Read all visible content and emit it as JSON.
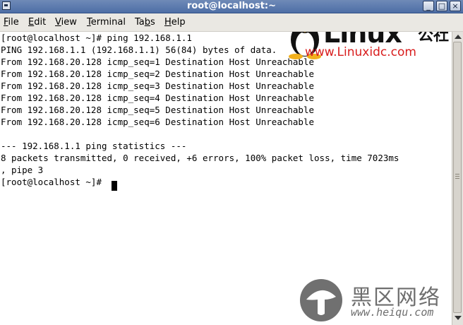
{
  "window": {
    "title": "root@localhost:~",
    "buttons": {
      "minimize": "_",
      "maximize": "□",
      "close": "×"
    }
  },
  "menu": {
    "items": [
      {
        "label_pre": "",
        "mnemonic": "F",
        "label_post": "ile"
      },
      {
        "label_pre": "",
        "mnemonic": "E",
        "label_post": "dit"
      },
      {
        "label_pre": "",
        "mnemonic": "V",
        "label_post": "iew"
      },
      {
        "label_pre": "",
        "mnemonic": "T",
        "label_post": "erminal"
      },
      {
        "label_pre": "Ta",
        "mnemonic": "b",
        "label_post": "s"
      },
      {
        "label_pre": "",
        "mnemonic": "H",
        "label_post": "elp"
      }
    ]
  },
  "terminal": {
    "lines": [
      "[root@localhost ~]# ping 192.168.1.1",
      "PING 192.168.1.1 (192.168.1.1) 56(84) bytes of data.",
      "From 192.168.20.128 icmp_seq=1 Destination Host Unreachable",
      "From 192.168.20.128 icmp_seq=2 Destination Host Unreachable",
      "From 192.168.20.128 icmp_seq=3 Destination Host Unreachable",
      "From 192.168.20.128 icmp_seq=4 Destination Host Unreachable",
      "From 192.168.20.128 icmp_seq=5 Destination Host Unreachable",
      "From 192.168.20.128 icmp_seq=6 Destination Host Unreachable",
      "",
      "--- 192.168.1.1 ping statistics ---",
      "8 packets transmitted, 0 received, +6 errors, 100% packet loss, time 7023ms",
      ", pipe 3",
      "[root@localhost ~]#"
    ]
  },
  "watermarks": {
    "top_brand": "Linux",
    "top_cn": "公社",
    "top_url": "www.Linuxidc.com",
    "bottom_cn": "黑区网络",
    "bottom_url": "www.heiqu.com",
    "colors": {
      "top_url": "#d81d1d",
      "bottom": "#6e6e6e"
    }
  }
}
